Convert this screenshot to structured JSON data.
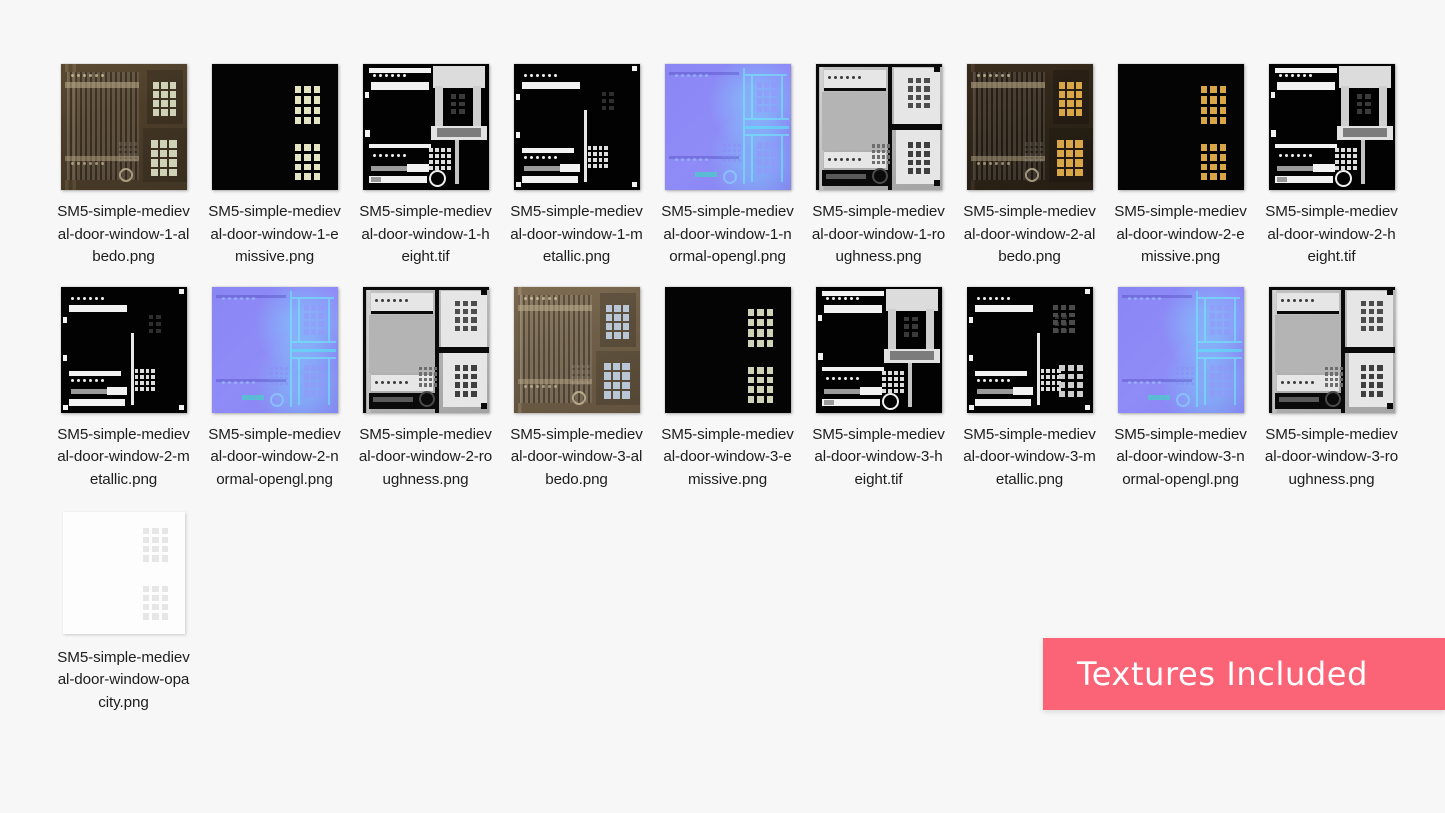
{
  "background_color": "#f7f7f7",
  "banner": {
    "text": "Textures Included",
    "background_color": "#fb6477",
    "text_color": "#ffffff"
  },
  "file_grid": {
    "columns": 9,
    "label_color": "#1d1d1d",
    "files": [
      {
        "name": "SM5-simple-medieval-door-window-1-albedo.png",
        "kind": "albedo",
        "variant": "1"
      },
      {
        "name": "SM5-simple-medieval-door-window-1-emissive.png",
        "kind": "emissive",
        "variant": "1"
      },
      {
        "name": "SM5-simple-medieval-door-window-1-height.tif",
        "kind": "height",
        "variant": "1"
      },
      {
        "name": "SM5-simple-medieval-door-window-1-metallic.png",
        "kind": "metallic",
        "variant": "1"
      },
      {
        "name": "SM5-simple-medieval-door-window-1-normal-opengl.png",
        "kind": "normal",
        "variant": "1"
      },
      {
        "name": "SM5-simple-medieval-door-window-1-roughness.png",
        "kind": "roughness",
        "variant": "1"
      },
      {
        "name": "SM5-simple-medieval-door-window-2-albedo.png",
        "kind": "albedo",
        "variant": "2"
      },
      {
        "name": "SM5-simple-medieval-door-window-2-emissive.png",
        "kind": "emissive",
        "variant": "2"
      },
      {
        "name": "SM5-simple-medieval-door-window-2-height.tif",
        "kind": "height",
        "variant": "2"
      },
      {
        "name": "SM5-simple-medieval-door-window-2-metallic.png",
        "kind": "metallic",
        "variant": "2"
      },
      {
        "name": "SM5-simple-medieval-door-window-2-normal-opengl.png",
        "kind": "normal",
        "variant": "2"
      },
      {
        "name": "SM5-simple-medieval-door-window-2-roughness.png",
        "kind": "roughness",
        "variant": "2"
      },
      {
        "name": "SM5-simple-medieval-door-window-3-albedo.png",
        "kind": "albedo",
        "variant": "3"
      },
      {
        "name": "SM5-simple-medieval-door-window-3-emissive.png",
        "kind": "emissive",
        "variant": "3"
      },
      {
        "name": "SM5-simple-medieval-door-window-3-height.tif",
        "kind": "height",
        "variant": "3"
      },
      {
        "name": "SM5-simple-medieval-door-window-3-metallic.png",
        "kind": "metallic",
        "variant": "3"
      },
      {
        "name": "SM5-simple-medieval-door-window-3-normal-opengl.png",
        "kind": "normal",
        "variant": "3"
      },
      {
        "name": "SM5-simple-medieval-door-window-3-roughness.png",
        "kind": "roughness",
        "variant": "3"
      },
      {
        "name": "SM5-simple-medieval-door-window-opacity.png",
        "kind": "opacity",
        "variant": ""
      }
    ]
  }
}
